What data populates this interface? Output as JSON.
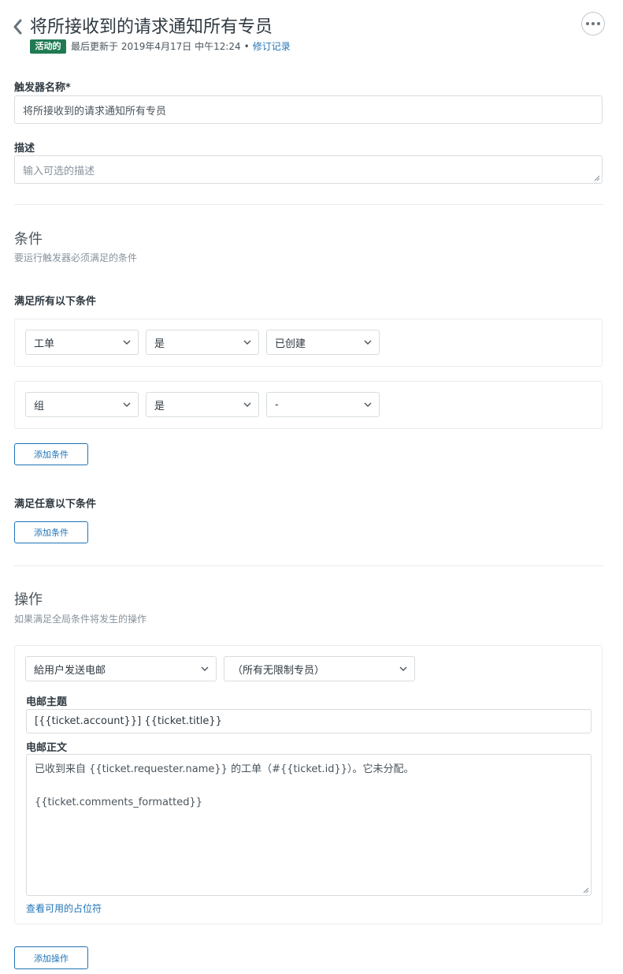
{
  "header": {
    "title": "将所接收到的请求通知所有专员",
    "status_badge": "活动的",
    "updated_text": "最后更新于 2019年4月17日 中午12:24",
    "separator": "•",
    "revision_link": "修订记录"
  },
  "form": {
    "name_label": "触发器名称*",
    "name_value": "将所接收到的请求通知所有专员",
    "description_label": "描述",
    "description_placeholder": "输入可选的描述"
  },
  "conditions": {
    "title": "条件",
    "description": "要运行触发器必须满足的条件",
    "all_label": "满足所有以下条件",
    "rows": [
      {
        "field": "工单",
        "operator": "是",
        "value": "已创建"
      },
      {
        "field": "组",
        "operator": "是",
        "value": "-"
      }
    ],
    "add_all_button": "添加条件",
    "any_label": "满足任意以下条件",
    "add_any_button": "添加条件"
  },
  "actions": {
    "title": "操作",
    "description": "如果满足全局条件将发生的操作",
    "action_select": "給用户发送电邮",
    "target_select": "（所有无限制专员）",
    "subject_label": "电邮主题",
    "subject_value": "[{{ticket.account}}] {{ticket.title}}",
    "body_label": "电邮正文",
    "body_line1": "已收到来自 {{ticket.requester.name}} 的工单（#{{ticket.id}}）。它未分配。",
    "body_line2": "{{ticket.comments_formatted}}",
    "placeholders_link": "查看可用的占位符",
    "add_action_button": "添加操作"
  },
  "colors": {
    "accent": "#1f73b7",
    "status_active": "#1f7a52",
    "border": "#d8dcde"
  },
  "icons": [
    "chevron-left-icon",
    "more-dots-icon",
    "chevron-down-icon",
    "resize-grip-icon"
  ]
}
